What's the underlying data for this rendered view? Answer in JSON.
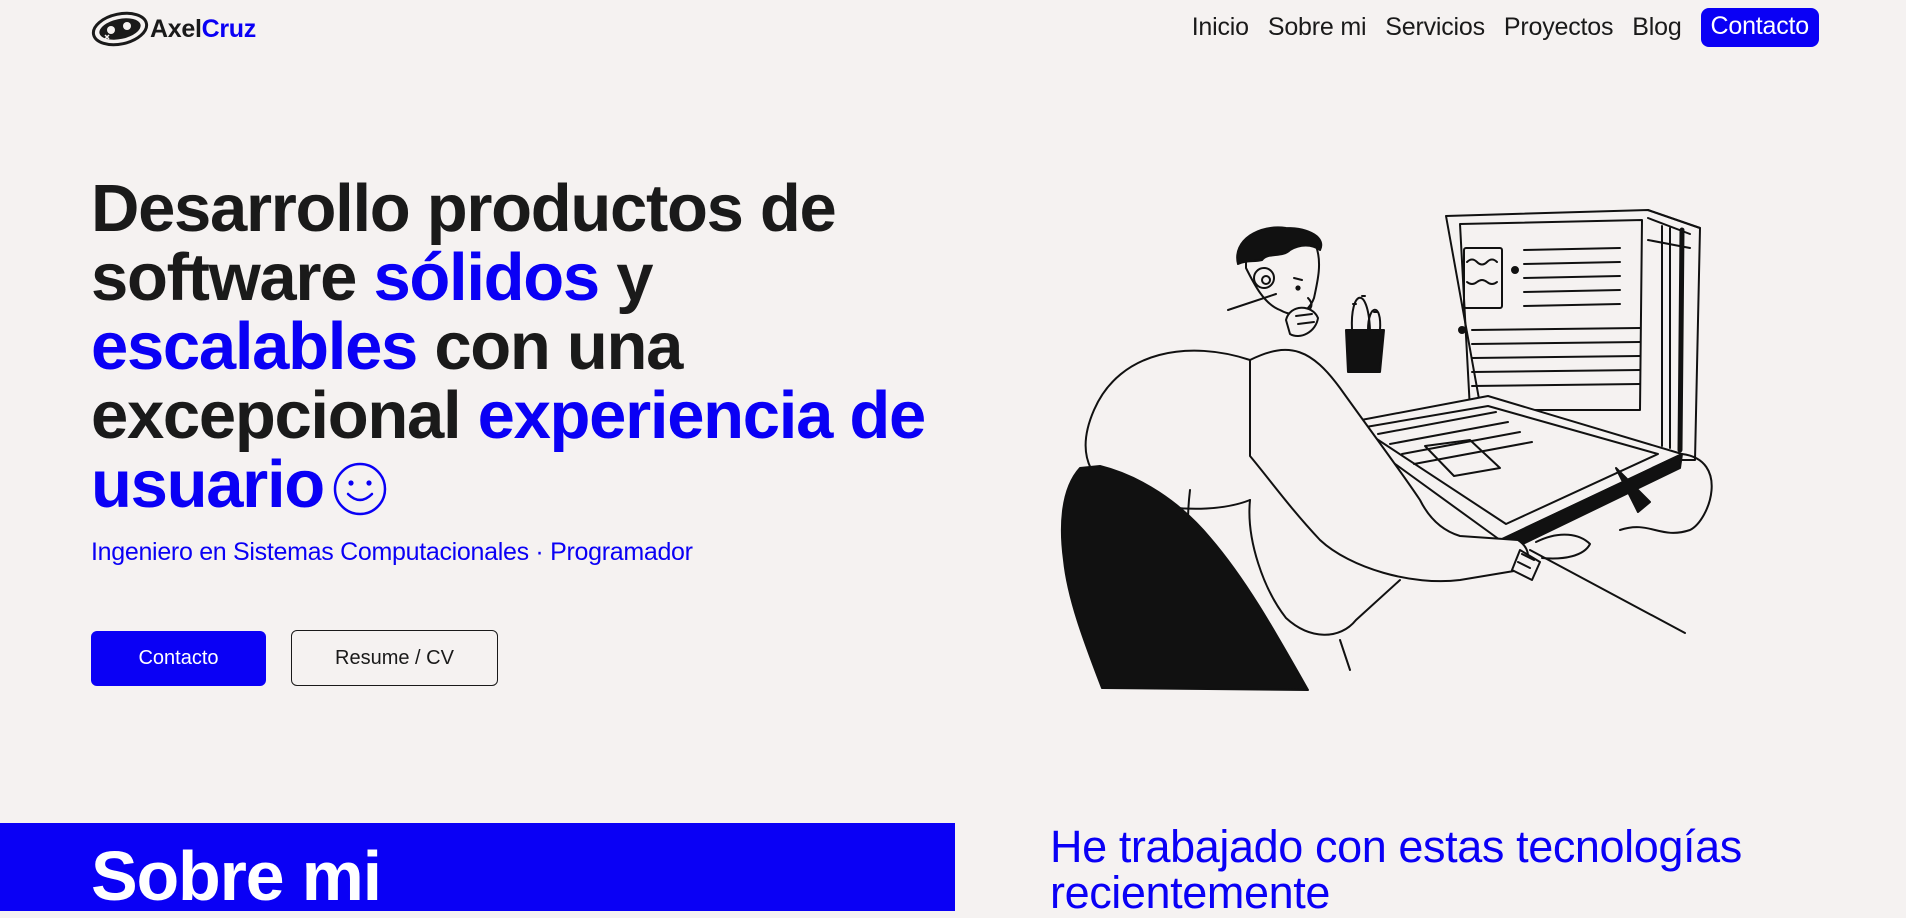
{
  "brand": {
    "name_part1": "Axel",
    "name_part2": "Cruz",
    "logo_icon": "gamepad-logo-icon"
  },
  "nav": {
    "items": [
      {
        "label": "Inicio"
      },
      {
        "label": "Sobre mi"
      },
      {
        "label": "Servicios"
      },
      {
        "label": "Proyectos"
      },
      {
        "label": "Blog"
      }
    ],
    "cta_label": "Contacto"
  },
  "hero": {
    "title_segments": [
      {
        "text": "Desarrollo productos de software ",
        "accent": false
      },
      {
        "text": "sólidos",
        "accent": true
      },
      {
        "text": " y ",
        "accent": false
      },
      {
        "text": "escalables",
        "accent": true
      },
      {
        "text": " con una excepcional ",
        "accent": false
      },
      {
        "text": "experiencia de usuario",
        "accent": true
      }
    ],
    "emoji_icon": "smiley-icon",
    "subtitle": "Ingeniero en Sistemas Computacionales · Programador",
    "primary_button": "Contacto",
    "secondary_button": "Resume / CV",
    "illustration": "person-at-laptop-illustration"
  },
  "about": {
    "title": "Sobre mi"
  },
  "tech": {
    "title": "He trabajado con estas tecnologías recientemente"
  },
  "colors": {
    "accent": "#0a00f5",
    "background": "#f5f2f1",
    "text": "#1a1a1a"
  }
}
